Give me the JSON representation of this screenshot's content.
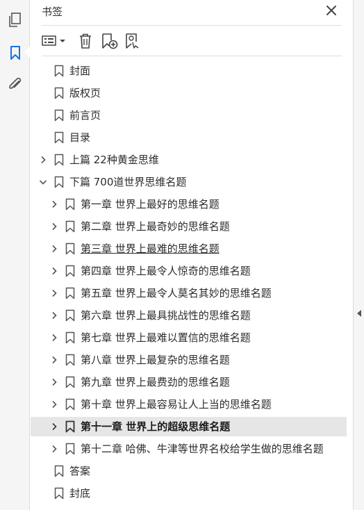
{
  "panel": {
    "title": "书签"
  },
  "icons": {
    "pages": "pages-icon",
    "bookmarks": "bookmark-panel-icon",
    "attachments": "paperclip-icon",
    "close": "close-icon",
    "options": "list-options-icon",
    "delete": "trash-icon",
    "new_bookmark": "bookmark-add-icon",
    "bookmark_from_selection": "bookmark-search-icon"
  },
  "colors": {
    "accent": "#1473e6",
    "selected_row": "#e6e6e6"
  },
  "bookmarks": [
    {
      "label": "封面",
      "level": 0,
      "expander": "none"
    },
    {
      "label": "版权页",
      "level": 0,
      "expander": "none"
    },
    {
      "label": "前言页",
      "level": 0,
      "expander": "none"
    },
    {
      "label": "目录",
      "level": 0,
      "expander": "none"
    },
    {
      "label": "上篇 22种黄金思维",
      "level": 0,
      "expander": "collapsed"
    },
    {
      "label": "下篇 700道世界思维名题",
      "level": 0,
      "expander": "expanded"
    },
    {
      "label": "第一章 世界上最好的思维名题",
      "level": 1,
      "expander": "collapsed"
    },
    {
      "label": "第二章 世界上最奇妙的思维名题",
      "level": 1,
      "expander": "collapsed"
    },
    {
      "label": "第三章 世界上最难的思维名题",
      "level": 1,
      "expander": "collapsed",
      "underline": true
    },
    {
      "label": "第四章 世界上最令人惊奇的思维名题",
      "level": 1,
      "expander": "collapsed"
    },
    {
      "label": "第五章 世界上最令人莫名其妙的思维名题",
      "level": 1,
      "expander": "collapsed"
    },
    {
      "label": "第六章 世界上最具挑战性的思维名题",
      "level": 1,
      "expander": "collapsed"
    },
    {
      "label": "第七章 世界上最难以置信的思维名题",
      "level": 1,
      "expander": "collapsed"
    },
    {
      "label": "第八章 世界上最复杂的思维名题",
      "level": 1,
      "expander": "collapsed"
    },
    {
      "label": "第九章 世界上最费劲的思维名题",
      "level": 1,
      "expander": "collapsed"
    },
    {
      "label": "第十章 世界上最容易让人上当的思维名题",
      "level": 1,
      "expander": "collapsed"
    },
    {
      "label": "第十一章 世界上的超级思维名题",
      "level": 1,
      "expander": "collapsed",
      "selected": true
    },
    {
      "label": "第十二章 哈佛、牛津等世界名校给学生做的思维名题",
      "level": 1,
      "expander": "collapsed"
    },
    {
      "label": "答案",
      "level": 0,
      "expander": "none"
    },
    {
      "label": "封底",
      "level": 0,
      "expander": "none"
    }
  ]
}
